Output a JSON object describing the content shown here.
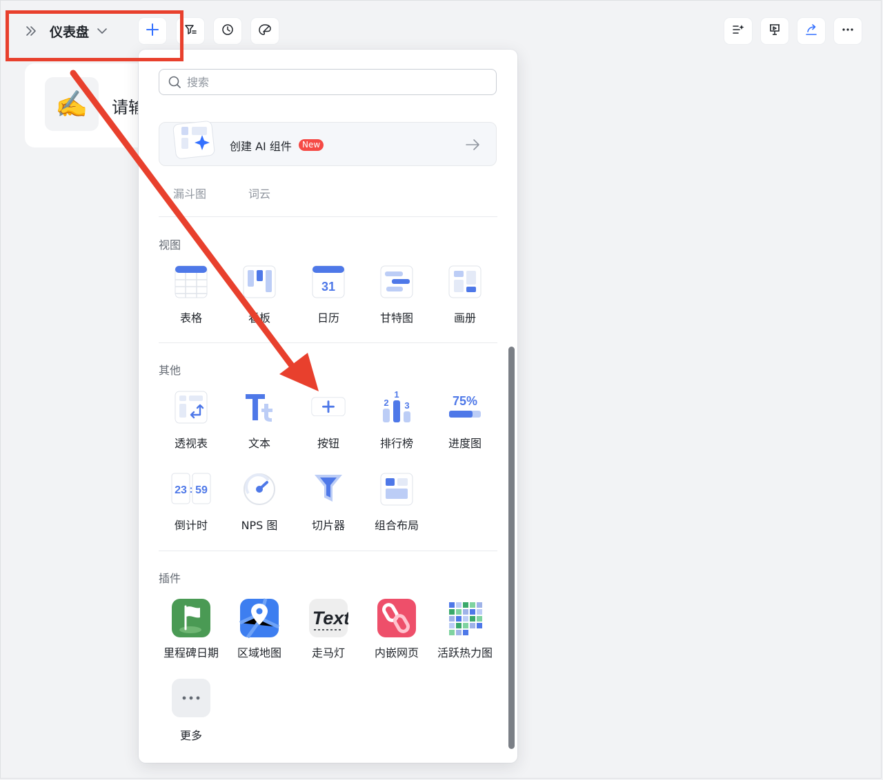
{
  "toolbar": {
    "title": "仪表盘",
    "left_icons": [
      "expand-sidebar-icon",
      "chevron-down-icon",
      "plus-icon",
      "filter-icon",
      "history-icon",
      "theme-icon"
    ],
    "right_icons": [
      "ai-settings-icon",
      "presentation-icon",
      "share-icon",
      "more-icon"
    ]
  },
  "background_card": {
    "emoji": "✍️",
    "text": "请输"
  },
  "popup": {
    "search_placeholder": "搜索",
    "ai_component": {
      "label": "创建 AI 组件",
      "badge": "New"
    },
    "truncated_row": [
      "漏斗图",
      "词云"
    ],
    "sections": [
      {
        "title": "视图",
        "items": [
          {
            "label": "表格",
            "icon": "table-icon"
          },
          {
            "label": "看板",
            "icon": "kanban-icon"
          },
          {
            "label": "日历",
            "icon": "calendar-icon",
            "glyph": "31"
          },
          {
            "label": "甘特图",
            "icon": "gantt-icon"
          },
          {
            "label": "画册",
            "icon": "gallery-icon"
          }
        ]
      },
      {
        "title": "其他",
        "items": [
          {
            "label": "透视表",
            "icon": "pivot-table-icon"
          },
          {
            "label": "文本",
            "icon": "text-icon"
          },
          {
            "label": "按钮",
            "icon": "button-plus-icon"
          },
          {
            "label": "排行榜",
            "icon": "leaderboard-icon",
            "glyphs": [
              "1",
              "2",
              "3"
            ]
          },
          {
            "label": "进度图",
            "icon": "progress-icon",
            "glyph": "75%"
          },
          {
            "label": "倒计时",
            "icon": "countdown-icon",
            "glyphs": [
              "23",
              ":",
              "59"
            ]
          },
          {
            "label": "NPS 图",
            "icon": "gauge-icon"
          },
          {
            "label": "切片器",
            "icon": "funnel-filter-icon"
          },
          {
            "label": "组合布局",
            "icon": "layout-icon"
          }
        ]
      },
      {
        "title": "插件",
        "items": [
          {
            "label": "里程碑日期",
            "icon": "milestone-flag-icon"
          },
          {
            "label": "区域地图",
            "icon": "map-pin-icon"
          },
          {
            "label": "走马灯",
            "icon": "marquee-text-icon",
            "glyph": "Text"
          },
          {
            "label": "内嵌网页",
            "icon": "embed-link-icon"
          },
          {
            "label": "活跃热力图",
            "icon": "heatmap-icon"
          },
          {
            "label": "更多",
            "icon": "more-dots-icon"
          }
        ]
      }
    ]
  },
  "colors": {
    "accent": "#3370ff",
    "annotation_red": "#e8402d",
    "badge_red": "#f54a45",
    "icon_blue": "#4e78e8",
    "icon_light_blue": "#bccdf6"
  }
}
